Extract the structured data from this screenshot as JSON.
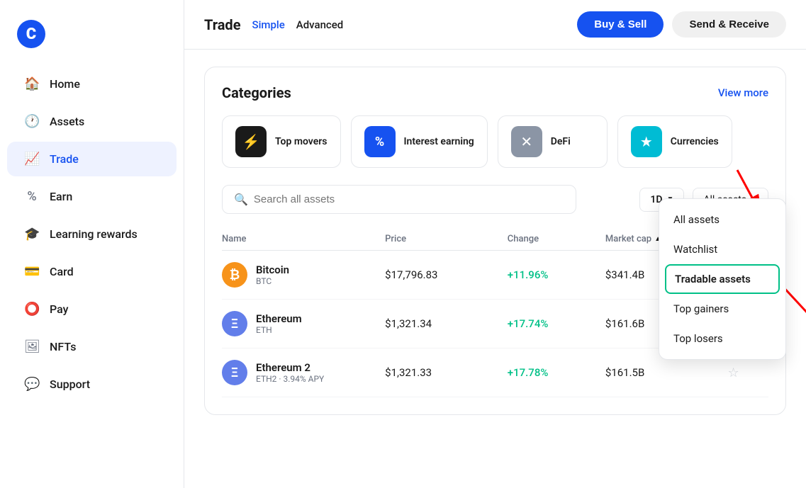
{
  "sidebar": {
    "logo": "C",
    "items": [
      {
        "id": "home",
        "label": "Home",
        "icon": "⌂"
      },
      {
        "id": "assets",
        "label": "Assets",
        "icon": "◷"
      },
      {
        "id": "trade",
        "label": "Trade",
        "icon": "↗",
        "active": true
      },
      {
        "id": "earn",
        "label": "Earn",
        "icon": "%"
      },
      {
        "id": "learning",
        "label": "Learning rewards",
        "icon": "⊙"
      },
      {
        "id": "card",
        "label": "Card",
        "icon": "▬"
      },
      {
        "id": "pay",
        "label": "Pay",
        "icon": "◯"
      },
      {
        "id": "nfts",
        "label": "NFTs",
        "icon": "⊕"
      },
      {
        "id": "support",
        "label": "Support",
        "icon": "▣"
      }
    ]
  },
  "header": {
    "title": "Trade",
    "tab_simple": "Simple",
    "tab_advanced": "Advanced",
    "btn_buy_sell": "Buy & Sell",
    "btn_send_receive": "Send & Receive"
  },
  "categories": {
    "section_title": "Categories",
    "view_more": "View more",
    "items": [
      {
        "id": "top_movers",
        "label": "Top movers",
        "icon": "⚡",
        "icon_class": "cat-icon-dark"
      },
      {
        "id": "interest_earning",
        "label": "Interest earning",
        "icon": "%",
        "icon_class": "cat-icon-blue"
      },
      {
        "id": "defi",
        "label": "DeFi",
        "icon": "✕",
        "icon_class": "cat-icon-gray"
      },
      {
        "id": "currencies",
        "label": "Currencies",
        "icon": "★",
        "icon_class": "cat-icon-teal"
      }
    ]
  },
  "search": {
    "placeholder": "Search all assets"
  },
  "period": {
    "value": "1D"
  },
  "asset_filter": {
    "value": "All assets"
  },
  "table": {
    "headers": [
      "Name",
      "Price",
      "Change",
      "Market cap",
      ""
    ],
    "rows": [
      {
        "name": "Bitcoin",
        "ticker": "BTC",
        "icon_bg": "#f7931a",
        "icon_text": "₿",
        "price": "$17,796.83",
        "change": "+11.96%",
        "market_cap": "$341.4B"
      },
      {
        "name": "Ethereum",
        "ticker": "ETH",
        "icon_bg": "#627eea",
        "icon_text": "Ξ",
        "price": "$1,321.34",
        "change": "+17.74%",
        "market_cap": "$161.6B"
      },
      {
        "name": "Ethereum 2",
        "ticker": "ETH2 · 3.94% APY",
        "icon_bg": "#627eea",
        "icon_text": "Ξ",
        "price": "$1,321.33",
        "change": "+17.78%",
        "market_cap": "$161.5B"
      }
    ]
  },
  "dropdown": {
    "items": [
      {
        "id": "all_assets",
        "label": "All assets",
        "highlighted": false
      },
      {
        "id": "watchlist",
        "label": "Watchlist",
        "highlighted": false
      },
      {
        "id": "tradable_assets",
        "label": "Tradable assets",
        "highlighted": true
      },
      {
        "id": "top_gainers",
        "label": "Top gainers",
        "highlighted": false
      },
      {
        "id": "top_losers",
        "label": "Top losers",
        "highlighted": false
      }
    ]
  }
}
